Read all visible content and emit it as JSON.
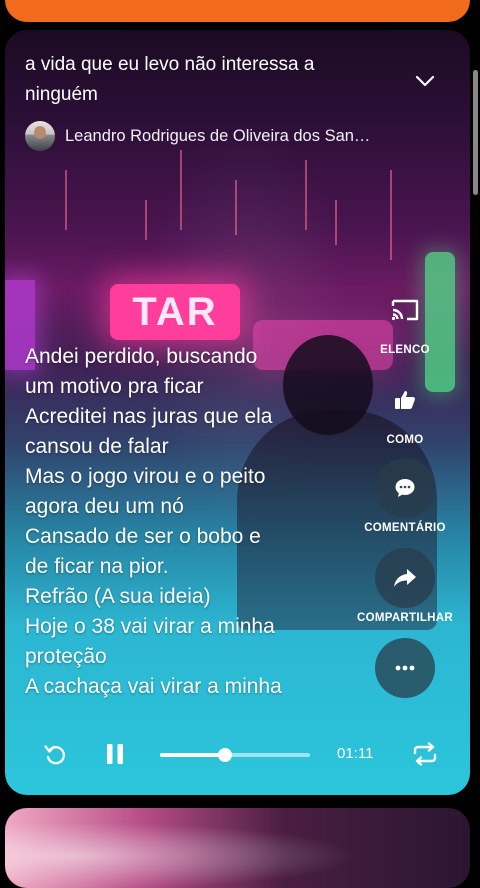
{
  "song": {
    "title": "a vida que eu levo não interessa a ninguém",
    "author": "Leandro Rodrigues de Oliveira dos San…"
  },
  "lyrics": [
    "Andei perdido, buscando",
    "um motivo pra ficar",
    "Acreditei nas juras que ela",
    "cansou de falar",
    "Mas o jogo virou e o peito",
    "agora deu um nó",
    "Cansado de ser o bobo e",
    "de ficar na pior.",
    "Refrão (A sua ideia)",
    "Hoje o 38 vai virar a minha",
    "proteção",
    "A cachaça vai virar a minha"
  ],
  "background_sign_text": "TAR",
  "actions": {
    "cast": {
      "label": "ELENCO",
      "icon": "cast-icon"
    },
    "like": {
      "label": "COMO",
      "icon": "thumbs-up-icon"
    },
    "comment": {
      "label": "COMENTÁRIO",
      "icon": "comment-icon"
    },
    "share": {
      "label": "COMPARTILHAR",
      "icon": "share-icon"
    },
    "more": {
      "icon": "more-icon"
    }
  },
  "player": {
    "time": "01:11",
    "progress": 0.43,
    "state": "playing"
  },
  "colors": {
    "prev_card": "#f26b1d",
    "accent_dark_button": "#283c4b"
  }
}
